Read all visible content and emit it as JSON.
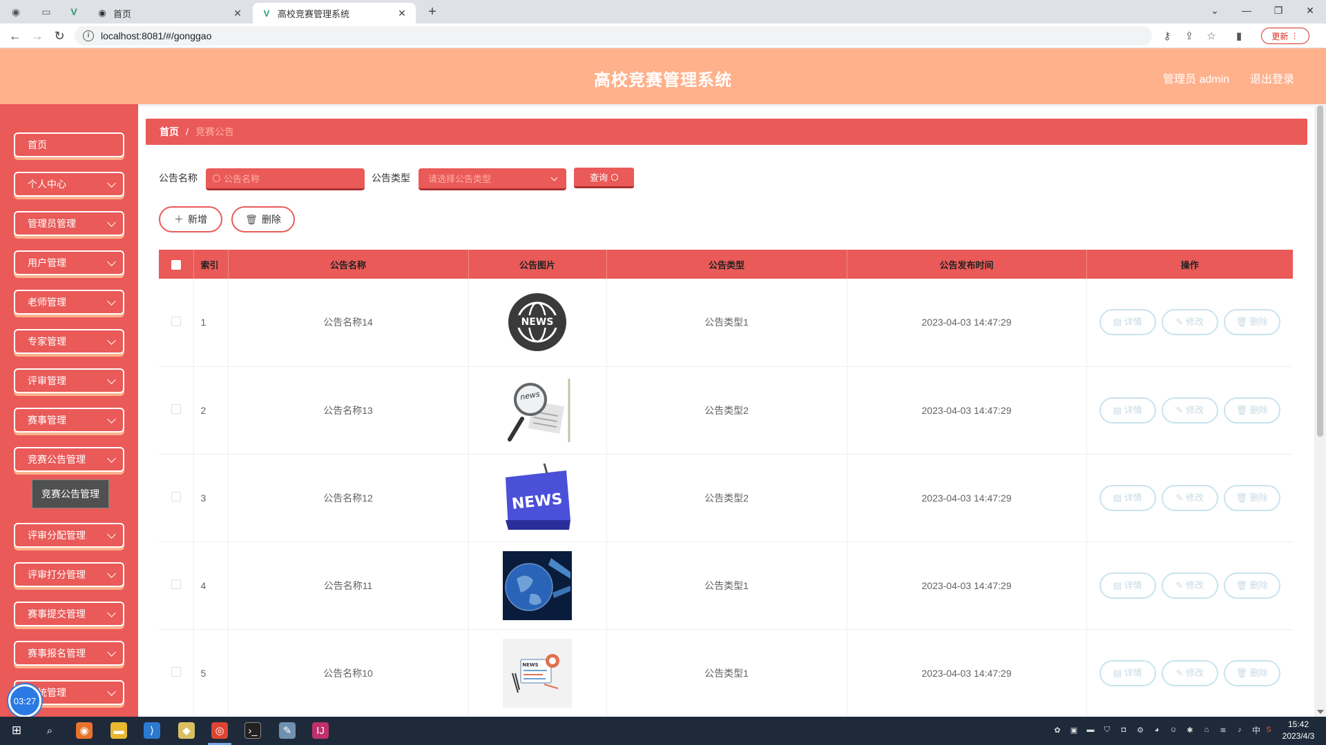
{
  "browser": {
    "tabs": [
      {
        "title": "首页",
        "active": false
      },
      {
        "title": "高校竞赛管理系统",
        "active": true
      }
    ],
    "url": "localhost:8081/#/gonggao",
    "update_label": "更新",
    "new_tab_symbol": "+"
  },
  "header": {
    "title": "高校竞赛管理系统",
    "admin_label": "管理员 admin",
    "logout_label": "退出登录"
  },
  "sidebar": {
    "items": [
      {
        "label": "首页",
        "has_submenu": false
      },
      {
        "label": "个人中心",
        "has_submenu": true
      },
      {
        "label": "管理员管理",
        "has_submenu": true
      },
      {
        "label": "用户管理",
        "has_submenu": true
      },
      {
        "label": "老师管理",
        "has_submenu": true
      },
      {
        "label": "专家管理",
        "has_submenu": true
      },
      {
        "label": "评审管理",
        "has_submenu": true
      },
      {
        "label": "赛事管理",
        "has_submenu": true
      },
      {
        "label": "竞赛公告管理",
        "has_submenu": true
      },
      {
        "label": "评审分配管理",
        "has_submenu": true
      },
      {
        "label": "评审打分管理",
        "has_submenu": true
      },
      {
        "label": "赛事提交管理",
        "has_submenu": true
      },
      {
        "label": "赛事报名管理",
        "has_submenu": true
      },
      {
        "label": "系统管理",
        "has_submenu": true
      }
    ],
    "tooltip": "竞赛公告管理",
    "timer": "03:27"
  },
  "breadcrumb": {
    "home": "首页",
    "separator": "/",
    "current": "竞赛公告"
  },
  "filters": {
    "name_label": "公告名称",
    "name_placeholder": "公告名称",
    "type_label": "公告类型",
    "type_placeholder": "请选择公告类型",
    "query_label": "查询"
  },
  "actions": {
    "add_label": "新增",
    "delete_label": "删除"
  },
  "table": {
    "columns": [
      "索引",
      "公告名称",
      "公告图片",
      "公告类型",
      "公告发布时间",
      "操作"
    ],
    "row_actions": {
      "detail": "详情",
      "edit": "修改",
      "delete": "删除"
    },
    "rows": [
      {
        "index": "1",
        "name": "公告名称14",
        "image": "news-globe-badge",
        "type": "公告类型1",
        "time": "2023-04-03 14:47:29"
      },
      {
        "index": "2",
        "name": "公告名称13",
        "image": "news-magnifier",
        "type": "公告类型2",
        "time": "2023-04-03 14:47:29"
      },
      {
        "index": "3",
        "name": "公告名称12",
        "image": "news-blue-key",
        "type": "公告类型2",
        "time": "2023-04-03 14:47:29"
      },
      {
        "index": "4",
        "name": "公告名称11",
        "image": "globe-blue",
        "type": "公告类型1",
        "time": "2023-04-03 14:47:29"
      },
      {
        "index": "5",
        "name": "公告名称10",
        "image": "news-illustration",
        "type": "公告类型1",
        "time": "2023-04-03 14:47:29"
      }
    ]
  },
  "taskbar": {
    "time": "15:42",
    "date": "2023/4/3",
    "ime": "中"
  },
  "colors": {
    "header": "#ffb18c",
    "sidebar": "#e95a58",
    "accent": "#e95a58"
  }
}
